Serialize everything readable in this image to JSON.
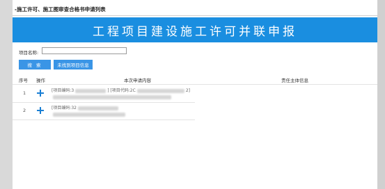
{
  "page": {
    "title": "-施工许可、施工图审查合格书申请列表"
  },
  "banner": {
    "text": "工程项目建设施工许可并联申报",
    "color": "#1a8ee0"
  },
  "search": {
    "label": "项目名称:",
    "value": "",
    "button_label": "搜 索",
    "not_found_label": "未找到项目信息"
  },
  "table": {
    "headers": [
      "序号",
      "操作",
      "本次申请内容",
      "责任主体信息"
    ],
    "rows": [
      {
        "seq": "1",
        "action_icon": "plus-icon",
        "line1_a": "[项目编码:3",
        "line1_b": "] [项目代码:2C",
        "line1_c": "2]"
      },
      {
        "seq": "2",
        "action_icon": "plus-icon",
        "line1_a": "[项目编码:32",
        "line1_b": "",
        "line1_c": ""
      }
    ]
  },
  "colors": {
    "accent": "#1a8ee0",
    "button": "#3a95e6",
    "icon": "#1a7fd4"
  }
}
